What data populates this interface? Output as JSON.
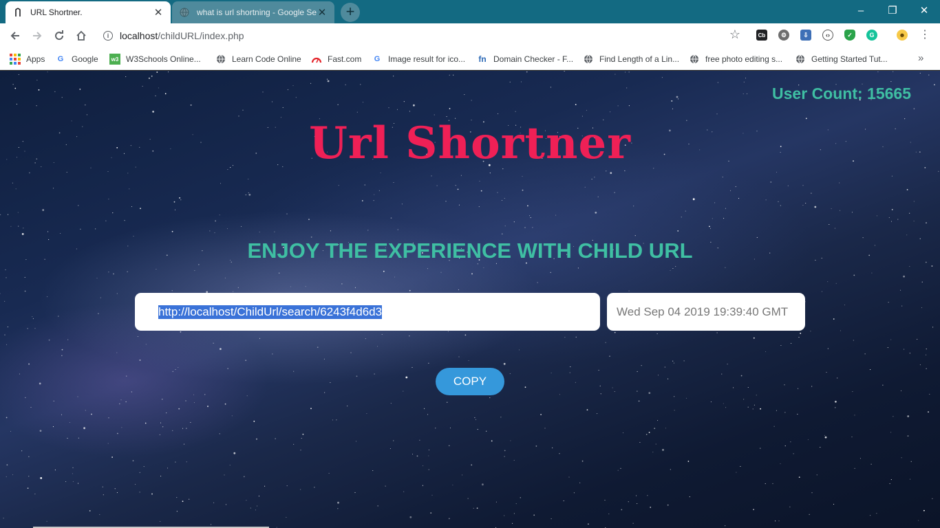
{
  "browser": {
    "tabs": [
      {
        "title": "URL Shortner.",
        "icon": "url-shortner-favicon",
        "active": true
      },
      {
        "title": "what is url shortning - Google Se",
        "icon": "globe-icon",
        "active": false
      }
    ],
    "new_tab_label": "+",
    "window_controls": {
      "minimize": "–",
      "restore": "❐",
      "close": "✕"
    },
    "address": {
      "host": "localhost",
      "path": "/childURL/index.php"
    },
    "bookmarks": [
      {
        "label": "Apps",
        "icon": "apps-grid-icon"
      },
      {
        "label": "Google",
        "icon": "google-icon"
      },
      {
        "label": "W3Schools Online...",
        "icon": "w3schools-icon"
      },
      {
        "label": "Learn Code Online",
        "icon": "globe-icon"
      },
      {
        "label": "Fast.com",
        "icon": "fast-speed-icon"
      },
      {
        "label": "Image result for ico...",
        "icon": "google-icon"
      },
      {
        "label": "Domain Checker - F...",
        "icon": "fn-icon"
      },
      {
        "label": "Find Length of a Lin...",
        "icon": "globe-icon"
      },
      {
        "label": "free photo editing s...",
        "icon": "globe-icon"
      },
      {
        "label": "Getting Started Tut...",
        "icon": "globe-icon"
      }
    ],
    "bookmarks_overflow": "»"
  },
  "page": {
    "user_count": "User Count: 15665",
    "title": "Url Shortner",
    "tagline": "ENJOY THE EXPERIENCE WITH CHILD URL",
    "short_url_value": "http://localhost/ChildUrl/search/6243f4d6d3",
    "date_value": "Wed Sep 04 2019 19:39:40 GMT",
    "copy_button": "COPY"
  },
  "colors": {
    "tab_strip": "#136a82",
    "title_pink": "#ef2056",
    "teal_text": "#3fbfa3",
    "copy_button": "#3598db",
    "selection": "#3a72d8"
  }
}
